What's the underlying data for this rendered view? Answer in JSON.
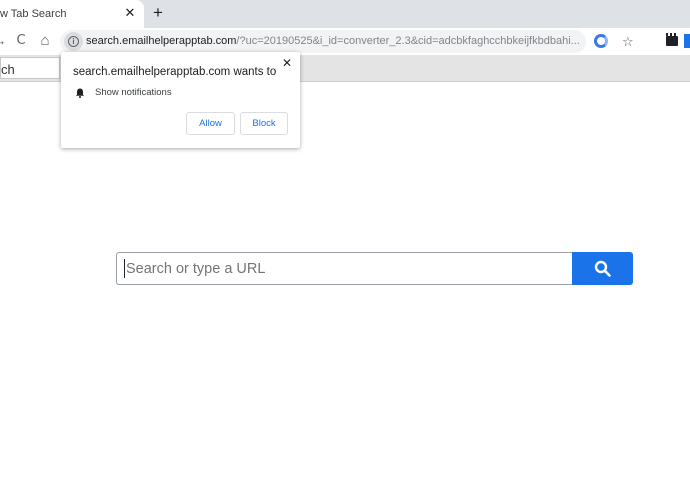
{
  "tab": {
    "title": "w Tab Search",
    "close_glyph": "✕",
    "new_tab_glyph": "+"
  },
  "toolbar": {
    "back_glyph": "→",
    "reload_glyph": "C",
    "home_glyph": "⌂",
    "url_host": "search.emailhelperapptab.com",
    "url_rest": "/?uc=20190525&i_id=converter_2.3&cid=adcbkfaghcchbkeijfkbdbahi...",
    "star_glyph": "☆"
  },
  "pagebar": {
    "search_text": "ch"
  },
  "popup": {
    "close_glyph": "✕",
    "title": "search.emailhelperapptab.com wants to",
    "permission": "Show notifications",
    "allow_label": "Allow",
    "block_label": "Block"
  },
  "search": {
    "placeholder": "Search or type a URL"
  },
  "colors": {
    "accent": "#1a73e8",
    "tabstrip": "#dee1e6",
    "pagebar": "#e4e4e4"
  },
  "icons": [
    "close-icon",
    "new-tab-icon",
    "reload-icon",
    "home-icon",
    "info-icon",
    "star-icon",
    "extension-icon",
    "clapper-icon",
    "bell-icon",
    "magnifier-icon"
  ]
}
